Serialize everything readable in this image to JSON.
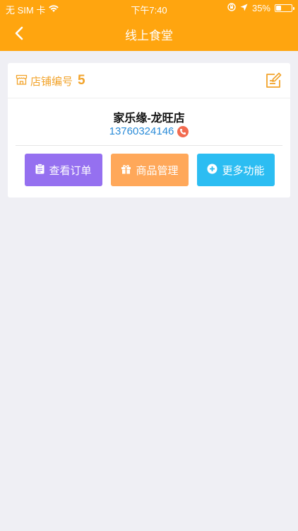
{
  "status_bar": {
    "carrier": "无 SIM 卡",
    "time": "下午7:40",
    "battery_percent": "35%",
    "battery_level": 0.35
  },
  "nav": {
    "title": "线上食堂",
    "back_icon": "chevron-left-icon"
  },
  "store": {
    "id_label": "店铺编号",
    "id_value": "5",
    "name": "家乐缘-龙旺店",
    "phone": "13760324146"
  },
  "actions": {
    "orders_label": "查看订单",
    "goods_label": "商品管理",
    "more_label": "更多功能"
  },
  "colors": {
    "header": "#ffa50f",
    "orders": "#9570f0",
    "goods": "#ffa85a",
    "more": "#2cbdf2",
    "phone_text": "#2a8bd8",
    "store_id": "#f2a32a"
  }
}
